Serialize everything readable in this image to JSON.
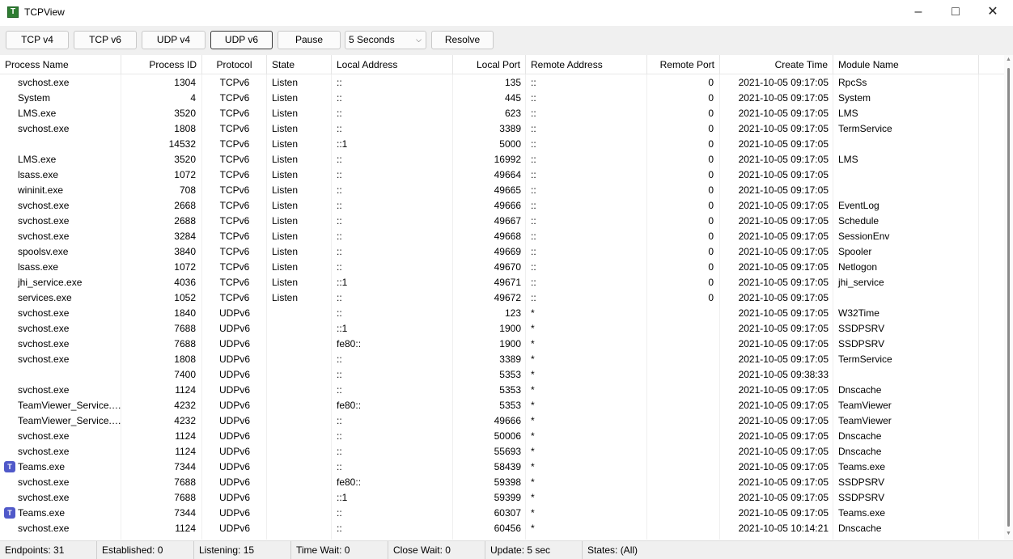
{
  "window": {
    "title": "TCPView",
    "icon": "tcpview-app-icon"
  },
  "toolbar": {
    "buttons": [
      {
        "label": "TCP v4",
        "active": false
      },
      {
        "label": "TCP v6",
        "active": false
      },
      {
        "label": "UDP v4",
        "active": false
      },
      {
        "label": "UDP v6",
        "active": true
      },
      {
        "label": "Pause",
        "active": false
      }
    ],
    "interval_select": {
      "value": "5 Seconds"
    },
    "resolve_label": "Resolve"
  },
  "columns": [
    "Process Name",
    "Process ID",
    "Protocol",
    "State",
    "Local Address",
    "Local Port",
    "Remote Address",
    "Remote Port",
    "Create Time",
    "Module Name"
  ],
  "rows": [
    {
      "process": "svchost.exe",
      "pid": "1304",
      "protocol": "TCPv6",
      "state": "Listen",
      "local_address": "::",
      "local_port": "135",
      "remote_address": "::",
      "remote_port": "0",
      "create_time": "2021-10-05 09:17:05",
      "module": "RpcSs",
      "icon": ""
    },
    {
      "process": "System",
      "pid": "4",
      "protocol": "TCPv6",
      "state": "Listen",
      "local_address": "::",
      "local_port": "445",
      "remote_address": "::",
      "remote_port": "0",
      "create_time": "2021-10-05 09:17:05",
      "module": "System",
      "icon": ""
    },
    {
      "process": "LMS.exe",
      "pid": "3520",
      "protocol": "TCPv6",
      "state": "Listen",
      "local_address": "::",
      "local_port": "623",
      "remote_address": "::",
      "remote_port": "0",
      "create_time": "2021-10-05 09:17:05",
      "module": "LMS",
      "icon": ""
    },
    {
      "process": "svchost.exe",
      "pid": "1808",
      "protocol": "TCPv6",
      "state": "Listen",
      "local_address": "::",
      "local_port": "3389",
      "remote_address": "::",
      "remote_port": "0",
      "create_time": "2021-10-05 09:17:05",
      "module": "TermService",
      "icon": ""
    },
    {
      "process": "",
      "pid": "14532",
      "protocol": "TCPv6",
      "state": "Listen",
      "local_address": "::1",
      "local_port": "5000",
      "remote_address": "::",
      "remote_port": "0",
      "create_time": "2021-10-05 09:17:05",
      "module": "",
      "icon": ""
    },
    {
      "process": "LMS.exe",
      "pid": "3520",
      "protocol": "TCPv6",
      "state": "Listen",
      "local_address": "::",
      "local_port": "16992",
      "remote_address": "::",
      "remote_port": "0",
      "create_time": "2021-10-05 09:17:05",
      "module": "LMS",
      "icon": ""
    },
    {
      "process": "lsass.exe",
      "pid": "1072",
      "protocol": "TCPv6",
      "state": "Listen",
      "local_address": "::",
      "local_port": "49664",
      "remote_address": "::",
      "remote_port": "0",
      "create_time": "2021-10-05 09:17:05",
      "module": "",
      "icon": ""
    },
    {
      "process": "wininit.exe",
      "pid": "708",
      "protocol": "TCPv6",
      "state": "Listen",
      "local_address": "::",
      "local_port": "49665",
      "remote_address": "::",
      "remote_port": "0",
      "create_time": "2021-10-05 09:17:05",
      "module": "",
      "icon": ""
    },
    {
      "process": "svchost.exe",
      "pid": "2668",
      "protocol": "TCPv6",
      "state": "Listen",
      "local_address": "::",
      "local_port": "49666",
      "remote_address": "::",
      "remote_port": "0",
      "create_time": "2021-10-05 09:17:05",
      "module": "EventLog",
      "icon": ""
    },
    {
      "process": "svchost.exe",
      "pid": "2688",
      "protocol": "TCPv6",
      "state": "Listen",
      "local_address": "::",
      "local_port": "49667",
      "remote_address": "::",
      "remote_port": "0",
      "create_time": "2021-10-05 09:17:05",
      "module": "Schedule",
      "icon": ""
    },
    {
      "process": "svchost.exe",
      "pid": "3284",
      "protocol": "TCPv6",
      "state": "Listen",
      "local_address": "::",
      "local_port": "49668",
      "remote_address": "::",
      "remote_port": "0",
      "create_time": "2021-10-05 09:17:05",
      "module": "SessionEnv",
      "icon": ""
    },
    {
      "process": "spoolsv.exe",
      "pid": "3840",
      "protocol": "TCPv6",
      "state": "Listen",
      "local_address": "::",
      "local_port": "49669",
      "remote_address": "::",
      "remote_port": "0",
      "create_time": "2021-10-05 09:17:05",
      "module": "Spooler",
      "icon": ""
    },
    {
      "process": "lsass.exe",
      "pid": "1072",
      "protocol": "TCPv6",
      "state": "Listen",
      "local_address": "::",
      "local_port": "49670",
      "remote_address": "::",
      "remote_port": "0",
      "create_time": "2021-10-05 09:17:05",
      "module": "Netlogon",
      "icon": ""
    },
    {
      "process": "jhi_service.exe",
      "pid": "4036",
      "protocol": "TCPv6",
      "state": "Listen",
      "local_address": "::1",
      "local_port": "49671",
      "remote_address": "::",
      "remote_port": "0",
      "create_time": "2021-10-05 09:17:05",
      "module": "jhi_service",
      "icon": ""
    },
    {
      "process": "services.exe",
      "pid": "1052",
      "protocol": "TCPv6",
      "state": "Listen",
      "local_address": "::",
      "local_port": "49672",
      "remote_address": "::",
      "remote_port": "0",
      "create_time": "2021-10-05 09:17:05",
      "module": "",
      "icon": ""
    },
    {
      "process": "svchost.exe",
      "pid": "1840",
      "protocol": "UDPv6",
      "state": "",
      "local_address": "::",
      "local_port": "123",
      "remote_address": "*",
      "remote_port": "",
      "create_time": "2021-10-05 09:17:05",
      "module": "W32Time",
      "icon": ""
    },
    {
      "process": "svchost.exe",
      "pid": "7688",
      "protocol": "UDPv6",
      "state": "",
      "local_address": "::1",
      "local_port": "1900",
      "remote_address": "*",
      "remote_port": "",
      "create_time": "2021-10-05 09:17:05",
      "module": "SSDPSRV",
      "icon": ""
    },
    {
      "process": "svchost.exe",
      "pid": "7688",
      "protocol": "UDPv6",
      "state": "",
      "local_address": "fe80::",
      "local_port": "1900",
      "remote_address": "*",
      "remote_port": "",
      "create_time": "2021-10-05 09:17:05",
      "module": "SSDPSRV",
      "icon": ""
    },
    {
      "process": "svchost.exe",
      "pid": "1808",
      "protocol": "UDPv6",
      "state": "",
      "local_address": "::",
      "local_port": "3389",
      "remote_address": "*",
      "remote_port": "",
      "create_time": "2021-10-05 09:17:05",
      "module": "TermService",
      "icon": ""
    },
    {
      "process": "",
      "pid": "7400",
      "protocol": "UDPv6",
      "state": "",
      "local_address": "::",
      "local_port": "5353",
      "remote_address": "*",
      "remote_port": "",
      "create_time": "2021-10-05 09:38:33",
      "module": "",
      "icon": ""
    },
    {
      "process": "svchost.exe",
      "pid": "1124",
      "protocol": "UDPv6",
      "state": "",
      "local_address": "::",
      "local_port": "5353",
      "remote_address": "*",
      "remote_port": "",
      "create_time": "2021-10-05 09:17:05",
      "module": "Dnscache",
      "icon": ""
    },
    {
      "process": "TeamViewer_Service.e...",
      "pid": "4232",
      "protocol": "UDPv6",
      "state": "",
      "local_address": "fe80::",
      "local_port": "5353",
      "remote_address": "*",
      "remote_port": "",
      "create_time": "2021-10-05 09:17:05",
      "module": "TeamViewer",
      "icon": ""
    },
    {
      "process": "TeamViewer_Service.e...",
      "pid": "4232",
      "protocol": "UDPv6",
      "state": "",
      "local_address": "::",
      "local_port": "49666",
      "remote_address": "*",
      "remote_port": "",
      "create_time": "2021-10-05 09:17:05",
      "module": "TeamViewer",
      "icon": ""
    },
    {
      "process": "svchost.exe",
      "pid": "1124",
      "protocol": "UDPv6",
      "state": "",
      "local_address": "::",
      "local_port": "50006",
      "remote_address": "*",
      "remote_port": "",
      "create_time": "2021-10-05 09:17:05",
      "module": "Dnscache",
      "icon": ""
    },
    {
      "process": "svchost.exe",
      "pid": "1124",
      "protocol": "UDPv6",
      "state": "",
      "local_address": "::",
      "local_port": "55693",
      "remote_address": "*",
      "remote_port": "",
      "create_time": "2021-10-05 09:17:05",
      "module": "Dnscache",
      "icon": ""
    },
    {
      "process": "Teams.exe",
      "pid": "7344",
      "protocol": "UDPv6",
      "state": "",
      "local_address": "::",
      "local_port": "58439",
      "remote_address": "*",
      "remote_port": "",
      "create_time": "2021-10-05 09:17:05",
      "module": "Teams.exe",
      "icon": "teams-icon"
    },
    {
      "process": "svchost.exe",
      "pid": "7688",
      "protocol": "UDPv6",
      "state": "",
      "local_address": "fe80::",
      "local_port": "59398",
      "remote_address": "*",
      "remote_port": "",
      "create_time": "2021-10-05 09:17:05",
      "module": "SSDPSRV",
      "icon": ""
    },
    {
      "process": "svchost.exe",
      "pid": "7688",
      "protocol": "UDPv6",
      "state": "",
      "local_address": "::1",
      "local_port": "59399",
      "remote_address": "*",
      "remote_port": "",
      "create_time": "2021-10-05 09:17:05",
      "module": "SSDPSRV",
      "icon": ""
    },
    {
      "process": "Teams.exe",
      "pid": "7344",
      "protocol": "UDPv6",
      "state": "",
      "local_address": "::",
      "local_port": "60307",
      "remote_address": "*",
      "remote_port": "",
      "create_time": "2021-10-05 09:17:05",
      "module": "Teams.exe",
      "icon": "teams-icon"
    },
    {
      "process": "svchost.exe",
      "pid": "1124",
      "protocol": "UDPv6",
      "state": "",
      "local_address": "::",
      "local_port": "60456",
      "remote_address": "*",
      "remote_port": "",
      "create_time": "2021-10-05 10:14:21",
      "module": "Dnscache",
      "icon": ""
    }
  ],
  "status": [
    "Endpoints: 31",
    "Established: 0",
    "Listening: 15",
    "Time Wait: 0",
    "Close Wait: 0",
    "Update: 5 sec",
    "States: (All)"
  ],
  "colors": {
    "toolbar_bg": "#f0f0f0",
    "teams_icon": "#5059c9",
    "app_icon": "#2e7d32"
  }
}
